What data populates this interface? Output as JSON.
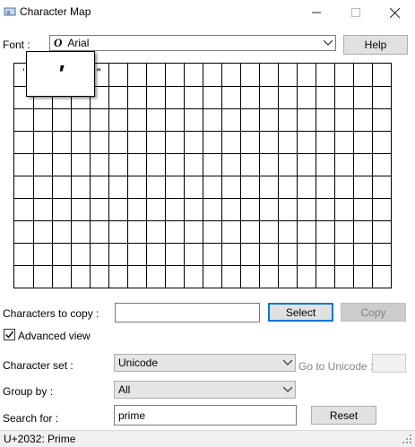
{
  "window": {
    "title": "Character Map"
  },
  "font": {
    "label": "Font :",
    "value": "Arial"
  },
  "help_button": "Help",
  "grid": {
    "chars": [
      "'",
      "′",
      "″",
      "‴"
    ],
    "zoom_char": "′"
  },
  "copy": {
    "label": "Characters to copy :",
    "value": "",
    "select_button": "Select",
    "copy_button": "Copy"
  },
  "advanced_view": {
    "label": "Advanced view",
    "checked": true
  },
  "character_set": {
    "label": "Character set :",
    "value": "Unicode"
  },
  "goto_unicode": {
    "label": "Go to Unicode :",
    "value": ""
  },
  "group_by": {
    "label": "Group by :",
    "value": "All"
  },
  "search": {
    "label": "Search for :",
    "value": "prime",
    "reset_button": "Reset"
  },
  "status": {
    "text": "U+2032: Prime"
  },
  "colors": {
    "accent": "#0078d7",
    "disabled_text": "#838383"
  }
}
